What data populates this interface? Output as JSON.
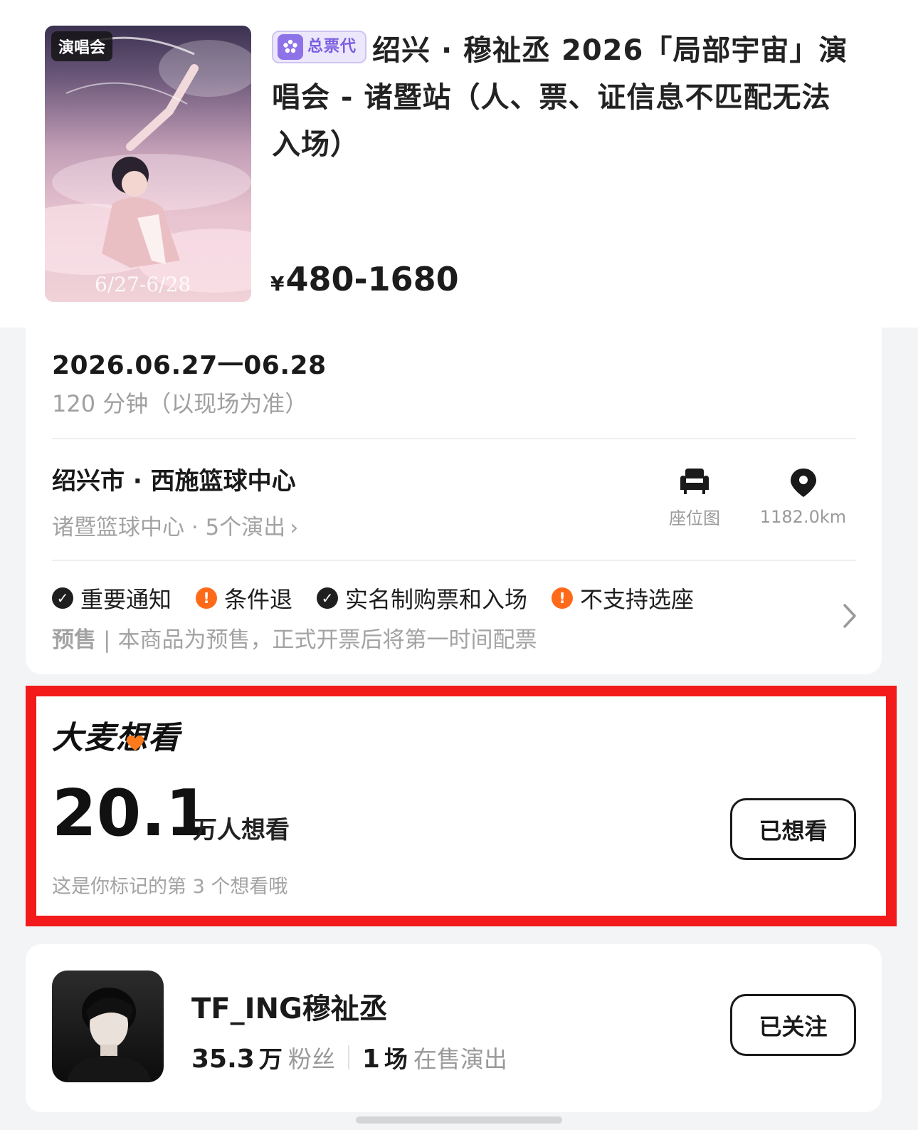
{
  "product": {
    "poster_tag": "演唱会",
    "poster_date": "6/27-6/28",
    "agent_badge": "总票代",
    "title": "绍兴 · 穆祉丞 2026「局部宇宙」演唱会 - 诸暨站（人、票、证信息不匹配无法入场）",
    "price_currency": "¥",
    "price_range": "480-1680"
  },
  "info": {
    "date": "2026.06.27一06.28",
    "duration": "120 分钟（以现场为准）",
    "venue_name": "绍兴市 · 西施篮球中心",
    "venue_sub": "诸暨篮球中心 · 5个演出",
    "seat_map_label": "座位图",
    "distance_label": "1182.0km",
    "tags": [
      {
        "label": "重要通知",
        "type": "ok"
      },
      {
        "label": "条件退",
        "type": "warn"
      },
      {
        "label": "实名制购票和入场",
        "type": "ok"
      },
      {
        "label": "不支持选座",
        "type": "warn"
      }
    ],
    "presale_label": "预售",
    "presale_text": "本商品为预售，正式开票后将第一时间配票"
  },
  "want": {
    "logo": "大麦想看",
    "count": "20.1",
    "unit": "万人想看",
    "note": "这是你标记的第 3 个想看哦",
    "button_label": "已想看"
  },
  "artist": {
    "name": "TF_ING穆祉丞",
    "fans_num": "35.3",
    "fans_unit": "万",
    "fans_label": "粉丝",
    "shows_num": "1",
    "shows_unit": "场",
    "shows_label": "在售演出",
    "follow_label": "已关注"
  },
  "colors": {
    "highlight_border": "#f21a1a",
    "warn": "#ff6a1a",
    "agent_badge": "#7b5ee0"
  },
  "icons": [
    "armchair-icon",
    "location-pin-icon",
    "check-circle-icon",
    "alert-circle-icon",
    "chevron-right-icon",
    "heart-icon"
  ]
}
